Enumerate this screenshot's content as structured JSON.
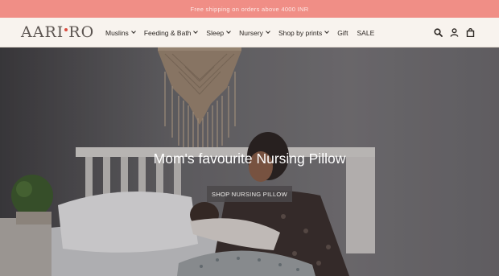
{
  "announcement": {
    "text": "Free shipping on orders above 4000 INR"
  },
  "brand": {
    "logo_part1": "AARI",
    "logo_part2": "RO"
  },
  "nav": {
    "items": [
      {
        "label": "Muslins",
        "has_dropdown": true
      },
      {
        "label": "Feeding & Bath",
        "has_dropdown": true
      },
      {
        "label": "Sleep",
        "has_dropdown": true
      },
      {
        "label": "Nursery",
        "has_dropdown": true
      },
      {
        "label": "Shop by prints",
        "has_dropdown": true
      },
      {
        "label": "Gift",
        "has_dropdown": false
      },
      {
        "label": "SALE",
        "has_dropdown": false
      }
    ]
  },
  "header_icons": [
    "search-icon",
    "account-icon",
    "cart-icon"
  ],
  "hero": {
    "title": "Mom's favourite Nursing Pillow",
    "button_label": "SHOP NURSING PILLOW"
  },
  "colors": {
    "announcement_bg": "#f08e86",
    "header_bg": "#f8f3ee",
    "logo_dot": "#d94b3f"
  }
}
